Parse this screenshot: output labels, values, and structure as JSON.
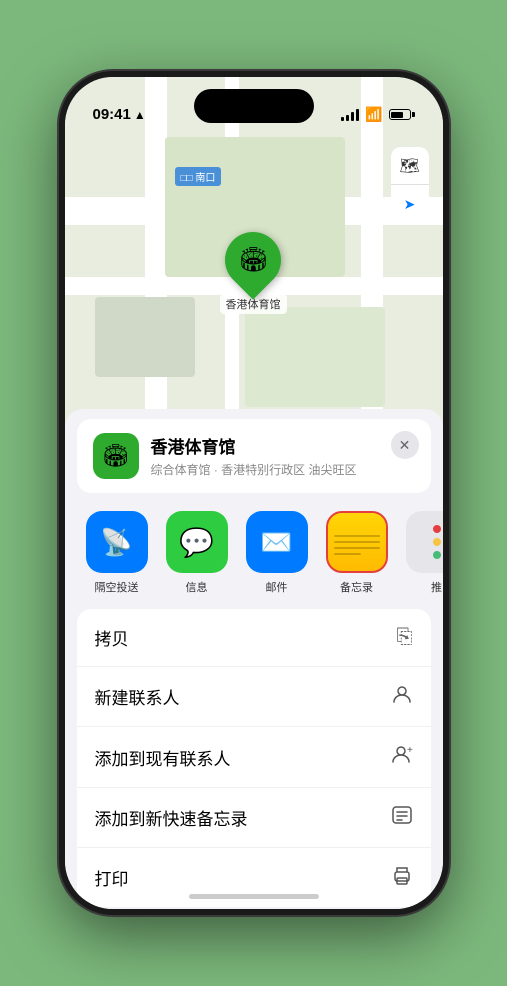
{
  "status_bar": {
    "time": "09:41",
    "location_icon": "▲"
  },
  "map": {
    "label_text": "南口",
    "label_prefix": "□□"
  },
  "controls": {
    "map_btn": "🗺",
    "location_btn": "➤"
  },
  "pin": {
    "label": "香港体育馆"
  },
  "place_card": {
    "name": "香港体育馆",
    "description": "综合体育馆 · 香港特别行政区 油尖旺区",
    "close": "✕"
  },
  "share_items": [
    {
      "label": "隔空投送",
      "type": "airdrop"
    },
    {
      "label": "信息",
      "type": "message"
    },
    {
      "label": "邮件",
      "type": "mail"
    },
    {
      "label": "备忘录",
      "type": "notes"
    },
    {
      "label": "推",
      "type": "more"
    }
  ],
  "actions": [
    {
      "label": "拷贝",
      "icon": "⎘"
    },
    {
      "label": "新建联系人",
      "icon": "👤"
    },
    {
      "label": "添加到现有联系人",
      "icon": "👤"
    },
    {
      "label": "添加到新快速备忘录",
      "icon": "🗒"
    },
    {
      "label": "打印",
      "icon": "🖨"
    }
  ]
}
